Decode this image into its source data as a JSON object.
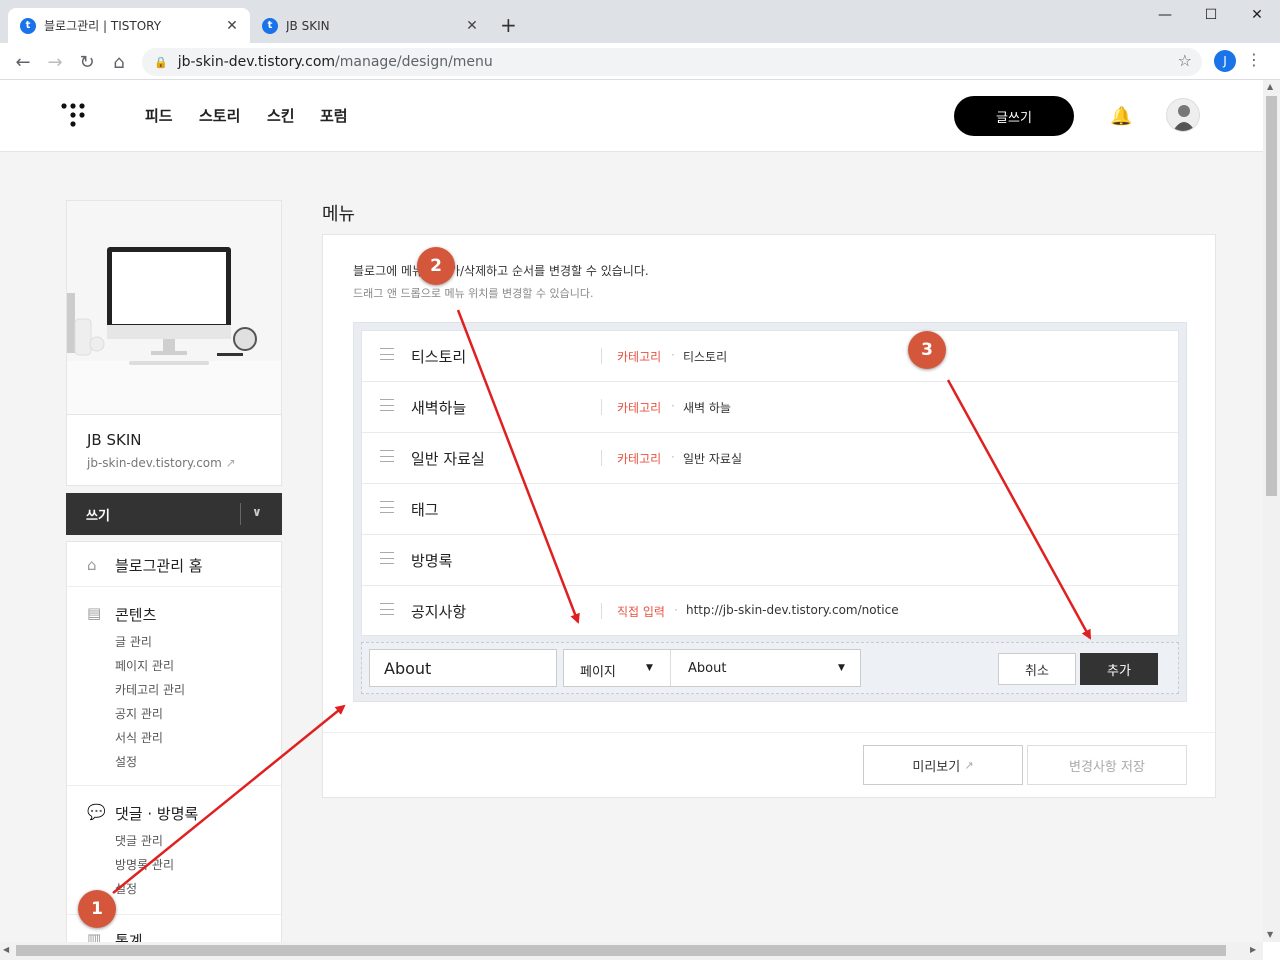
{
  "browser": {
    "tabs": [
      {
        "label": "블로그관리 | TISTORY",
        "favicon": "t"
      },
      {
        "label": "JB SKIN",
        "favicon": "t"
      }
    ],
    "url_host": "jb-skin-dev.tistory.com",
    "url_path": "/manage/design/menu",
    "profile_initial": "J"
  },
  "header": {
    "nav": [
      "피드",
      "스토리",
      "스킨",
      "포럼"
    ],
    "write_label": "글쓰기"
  },
  "sidebar": {
    "blog_name": "JB SKIN",
    "blog_url": "jb-skin-dev.tistory.com",
    "write_label": "쓰기",
    "home_label": "블로그관리 홈",
    "contents": {
      "title": "콘텐츠",
      "items": [
        "글 관리",
        "페이지 관리",
        "카테고리 관리",
        "공지 관리",
        "서식 관리",
        "설정"
      ]
    },
    "comments": {
      "title": "댓글 · 방명록",
      "items": [
        "댓글 관리",
        "방명록 관리",
        "설정"
      ]
    },
    "stats_title": "통계"
  },
  "main": {
    "title": "메뉴",
    "desc1": "블로그에 메뉴를 추가/삭제하고 순서를 변경할 수 있습니다.",
    "desc2": "드래그 앤 드롭으로 메뉴 위치를 변경할 수 있습니다.",
    "menu_items": [
      {
        "name": "티스토리",
        "type": "카테고리",
        "value": "티스토리"
      },
      {
        "name": "새벽하늘",
        "type": "카테고리",
        "value": "새벽 하늘"
      },
      {
        "name": "일반 자료실",
        "type": "카테고리",
        "value": "일반 자료실"
      },
      {
        "name": "태그",
        "type": "",
        "value": ""
      },
      {
        "name": "방명록",
        "type": "",
        "value": ""
      },
      {
        "name": "공지사항",
        "type": "직접 입력",
        "value": "http://jb-skin-dev.tistory.com/notice"
      }
    ],
    "add_form": {
      "name_value": "About",
      "type_selected": "페이지",
      "target_selected": "About",
      "cancel_label": "취소",
      "add_label": "추가"
    },
    "preview_label": "미리보기",
    "save_label": "변경사항 저장"
  },
  "annotations": {
    "badges": [
      "1",
      "2",
      "3"
    ],
    "color": "#e02020"
  },
  "colors": {
    "accent_red": "#e95340",
    "dark_button": "#333333"
  }
}
